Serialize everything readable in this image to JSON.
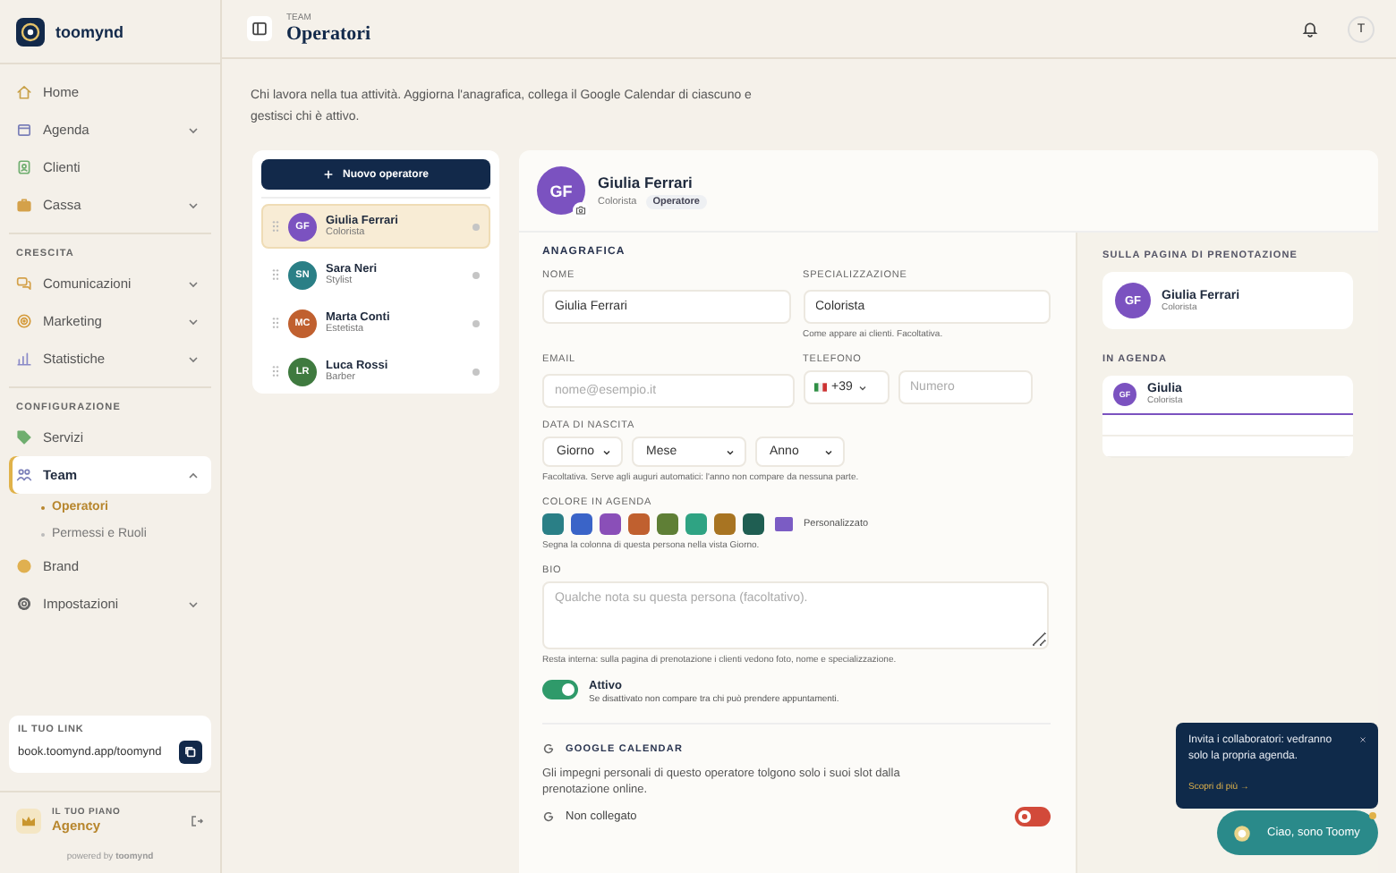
{
  "brand": {
    "name": "toomynd"
  },
  "sidebar": {
    "sections": [
      {
        "items": [
          {
            "label": "Home",
            "selected": false
          },
          {
            "label": "Agenda",
            "selected": false,
            "expanded": false
          },
          {
            "label": "Clienti",
            "selected": false
          },
          {
            "label": "Cassa",
            "selected": false,
            "expanded": false
          }
        ]
      },
      {
        "title": "CRESCITA",
        "items": [
          {
            "label": "Comunicazioni",
            "selected": false,
            "expanded": false
          },
          {
            "label": "Marketing",
            "selected": false,
            "expanded": false
          },
          {
            "label": "Statistiche",
            "selected": false,
            "expanded": false
          }
        ]
      },
      {
        "title": "CONFIGURAZIONE",
        "items": [
          {
            "label": "Servizi",
            "selected": false
          },
          {
            "label": "Team",
            "selected": true,
            "expanded": true,
            "children": [
              {
                "label": "Operatori",
                "selected": true
              },
              {
                "label": "Permessi e Ruoli",
                "selected": false
              }
            ]
          },
          {
            "label": "Brand",
            "selected": false
          },
          {
            "label": "Impostazioni",
            "selected": false,
            "expanded": false
          }
        ]
      }
    ],
    "link": {
      "label": "IL TUO LINK",
      "url": "book.toomynd.app/toomynd"
    },
    "plan": {
      "label": "IL TUO PIANO",
      "name": "Agency"
    },
    "powered": "powered by **toomynd**"
  },
  "header": {
    "eyebrow": "TEAM",
    "title": "Operatori",
    "user_initial": "T"
  },
  "intro": "Chi lavora nella tua attività. Aggiorna l'anagrafica, collega il Google Calendar di ciascuno e gestisci chi è attivo.",
  "operators": {
    "new_button": "Nuovo operatore",
    "items": [
      {
        "initials": "GF",
        "name": "Giulia Ferrari",
        "role": "Colorista",
        "color": "#7b52c0",
        "selected": true
      },
      {
        "initials": "SN",
        "name": "Sara Neri",
        "role": "Stylist",
        "color": "#2a7f86",
        "selected": false
      },
      {
        "initials": "MC",
        "name": "Marta Conti",
        "role": "Estetista",
        "color": "#c0602f",
        "selected": false
      },
      {
        "initials": "LR",
        "name": "Luca Rossi",
        "role": "Barber",
        "color": "#3f7a3f",
        "selected": false
      }
    ]
  },
  "detail": {
    "header": {
      "initials": "GF",
      "name": "Giulia Ferrari",
      "role": "Colorista",
      "badge": "Operatore",
      "color": "#7b52c0"
    },
    "section_title": "ANAGRAFICA",
    "name_field": {
      "label": "NOME",
      "value": "Giulia Ferrari"
    },
    "specialization": {
      "label": "SPECIALIZZAZIONE",
      "value": "Colorista",
      "hint": "Come appare ai clienti. Facoltativa."
    },
    "email": {
      "label": "EMAIL",
      "placeholder": "nome@esempio.it"
    },
    "phone": {
      "label": "TELEFONO",
      "prefix": "+39",
      "placeholder": "Numero"
    },
    "birth": {
      "label": "DATA DI NASCITA",
      "selects": [
        "Giorno",
        "Mese",
        "Anno"
      ],
      "hint": "Facoltativa. Serve agli auguri automatici: l'anno non compare da nessuna parte."
    },
    "colors": {
      "label": "COLORE IN AGENDA",
      "swatches": [
        {
          "color": "#2a7f86"
        },
        {
          "color": "#3a64c8"
        },
        {
          "color": "#8a4fb8"
        },
        {
          "color": "#c0602f"
        },
        {
          "color": "#5f7f36"
        },
        {
          "color": "#2fa383"
        },
        {
          "color": "#a87422"
        },
        {
          "color": "#1f5e52"
        }
      ],
      "custom": {
        "label": "Personalizzato",
        "color": "#7b5cc4"
      },
      "hint": "Segna la colonna di questa persona nella vista Giorno."
    },
    "bio": {
      "label": "BIO",
      "placeholder": "Qualche nota su questa persona (facoltativo).",
      "hint": "Resta interna: sulla pagina di prenotazione i clienti vedono foto, nome e specializzazione."
    },
    "active": {
      "label": "Attivo",
      "description": "Se disattivato non compare tra chi può prendere appuntamenti.",
      "on": true
    },
    "google": {
      "title": "GOOGLE CALENDAR",
      "description": "Gli impegni personali di questo operatore tolgono solo i suoi slot dalla prenotazione online.",
      "status": "Non collegato",
      "on": false
    }
  },
  "preview": {
    "booking_title": "SULLA PAGINA DI PRENOTAZIONE",
    "booking_card": {
      "initials": "GF",
      "name": "Giulia Ferrari",
      "role": "Colorista",
      "color": "#7b52c0"
    },
    "agenda_title": "IN AGENDA",
    "agenda_card": {
      "initials": "GF",
      "name": "Giulia",
      "role": "Colorista",
      "color": "#7b52c0"
    }
  },
  "toast": {
    "text": "Invita i collaboratori: vedranno solo la propria agenda.",
    "link": "Scopri di più →"
  },
  "chat": {
    "label": "Ciao, sono Toomy",
    "notification": true
  }
}
